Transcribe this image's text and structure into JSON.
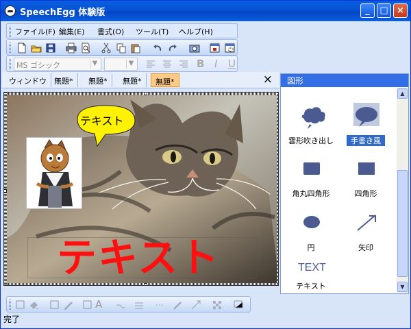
{
  "window": {
    "title": "SpeechEgg 体験版",
    "minimize": "_",
    "maximize": "□",
    "close": "×"
  },
  "menu": {
    "items": [
      "ファイル(F)",
      "編集(E)",
      "書式(O)",
      "ツール(T)",
      "ヘルプ(H)"
    ]
  },
  "format_toolbar": {
    "font": "MS ゴシック",
    "size": "",
    "bold": "B",
    "italic": "I",
    "underline": "U"
  },
  "tabs": {
    "items": [
      "ウィンドウ",
      "無題*",
      "無題*",
      "無題*",
      "無題*"
    ],
    "active": 4,
    "close": "×"
  },
  "canvas": {
    "speech_bubble_text": "テキスト",
    "big_text": "テキスト",
    "big_text_color": "#ff1010",
    "bubble_color": "#fff200"
  },
  "panel": {
    "title": "図形",
    "shapes": [
      {
        "label": "雲形吹き出し",
        "icon": "cloud-balloon-icon",
        "selected": false
      },
      {
        "label": "手書き風",
        "icon": "handwritten-balloon-icon",
        "selected": true
      },
      {
        "label": "角丸四角形",
        "icon": "rounded-rectangle-icon",
        "selected": false
      },
      {
        "label": "四角形",
        "icon": "rectangle-icon",
        "selected": false
      },
      {
        "label": "円",
        "icon": "ellipse-icon",
        "selected": false
      },
      {
        "label": "矢印",
        "icon": "arrow-icon",
        "selected": false
      },
      {
        "label": "テキスト",
        "icon": "text-icon",
        "preview": "TEXT",
        "selected": false
      }
    ],
    "shape_color": "#4b5b92"
  },
  "status": {
    "text": "完了"
  }
}
